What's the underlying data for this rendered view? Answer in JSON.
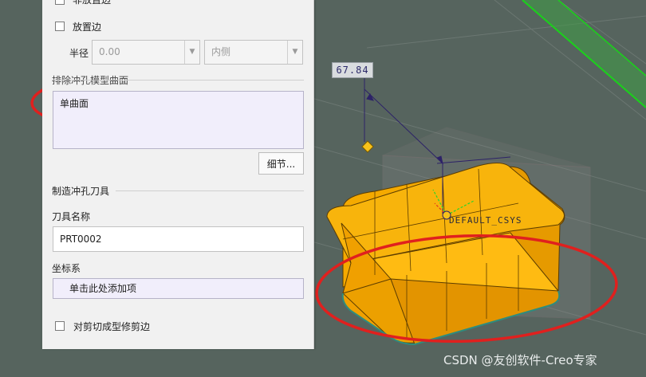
{
  "panel": {
    "top_partial_checkbox_label": "非放置边",
    "place_edge_label": "放置边",
    "radius_label": "半径",
    "radius_value": "0.00",
    "side_value": "内侧",
    "exclude_surface_section": "排除冲孔模型曲面",
    "surface_collector_value": "单曲面",
    "details_button": "细节...",
    "tool_section": "制造冲孔刀具",
    "tool_name_label": "刀具名称",
    "tool_name_value": "PRT0002",
    "csys_label": "坐标系",
    "csys_collector_placeholder": "单击此处添加项",
    "trim_edges_label": "对剪切成型修剪边"
  },
  "viewport": {
    "dimension_value": "67.84",
    "csys_name": "DEFAULT_CSYS",
    "model_color": "#f5a700",
    "background_color": "#56645e",
    "annotation_color": "#e0201e"
  },
  "watermark": "CSDN @友创软件-Creo专家"
}
